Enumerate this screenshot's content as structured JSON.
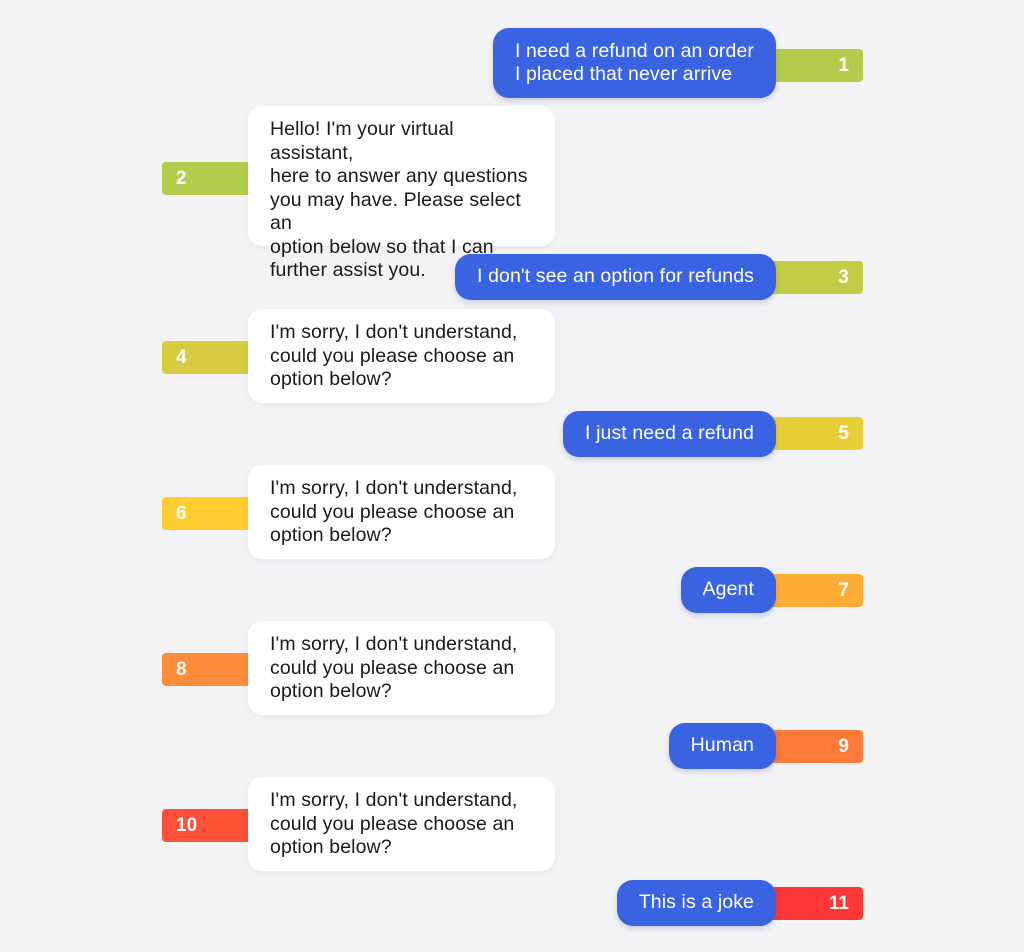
{
  "messages": [
    {
      "n": "1",
      "from": "user",
      "text": "I need a refund on an order\nI placed that never arrive",
      "color": "#b4cb4b"
    },
    {
      "n": "2",
      "from": "bot",
      "text": "Hello! I'm your virtual assistant,\nhere to answer any questions\nyou may have. Please select an\noption below so that I can\nfurther assist you.",
      "color": "#b2cc4c"
    },
    {
      "n": "3",
      "from": "user",
      "text": "I don't see an option for refunds",
      "color": "#c2cc45"
    },
    {
      "n": "4",
      "from": "bot",
      "text": "I'm sorry, I don't understand,\ncould you please choose an\noption below?",
      "color": "#d6cc40"
    },
    {
      "n": "5",
      "from": "user",
      "text": "I just need a refund",
      "color": "#e8ce36"
    },
    {
      "n": "6",
      "from": "bot",
      "text": "I'm sorry, I don't understand,\ncould you please choose an\noption below?",
      "color": "#fccc30"
    },
    {
      "n": "7",
      "from": "user",
      "text": "Agent",
      "color": "#fdac36"
    },
    {
      "n": "8",
      "from": "bot",
      "text": "I'm sorry, I don't understand,\ncould you please choose an\noption below?",
      "color": "#fc8c3a"
    },
    {
      "n": "9",
      "from": "user",
      "text": "Human",
      "color": "#fd7a3a"
    },
    {
      "n": "10",
      "from": "bot",
      "text": "I'm sorry, I don't understand,\ncould you please choose an\noption below?",
      "color": "#fd5138"
    },
    {
      "n": "11",
      "from": "user",
      "text": "This is a joke",
      "color": "#fd3636"
    }
  ]
}
